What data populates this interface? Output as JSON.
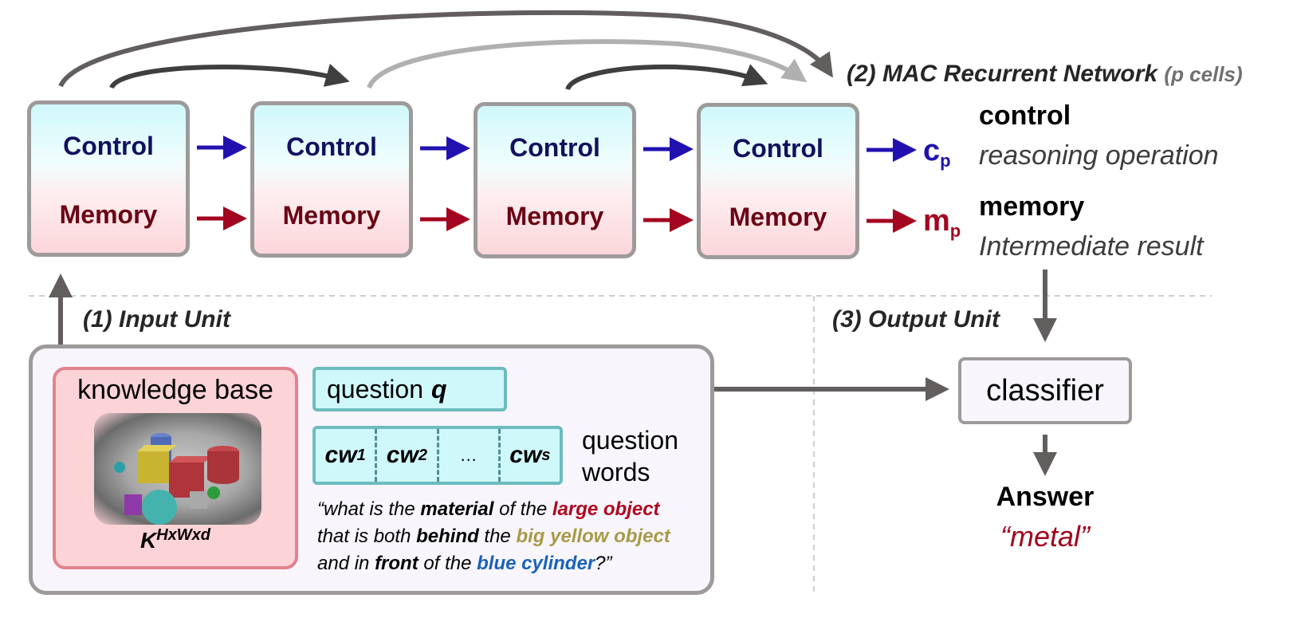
{
  "colors": {
    "control": "#2112b0",
    "memory": "#a3041f",
    "arrow_gray": "#625e5e",
    "arc_dark": "#3f3f3f",
    "arc_light": "#b0b0b0",
    "highlight_red": "#b0051e",
    "highlight_yellow": "#a89a48",
    "highlight_blue": "#1a63b7",
    "answer": "#a3041f"
  },
  "mac_network": {
    "title": "(2) MAC Recurrent Network",
    "title_suffix": "(p cells)",
    "cells": [
      {
        "control": "Control",
        "memory": "Memory"
      },
      {
        "control": "Control",
        "memory": "Memory"
      },
      {
        "control": "Control",
        "memory": "Memory"
      },
      {
        "control": "Control",
        "memory": "Memory"
      }
    ],
    "outputs": {
      "control_symbol": "c",
      "control_sub": "p",
      "memory_symbol": "m",
      "memory_sub": "p"
    },
    "legend": {
      "control_title": "control",
      "control_desc": "reasoning operation",
      "memory_title": "memory",
      "memory_desc": "Intermediate result"
    }
  },
  "input_unit": {
    "title": "(1) Input Unit",
    "knowledge_base": {
      "label": "knowledge base",
      "var": "K",
      "var_sup": "HxWxd",
      "image": "clevr-scene"
    },
    "question": {
      "label": "question",
      "var": "q"
    },
    "contextual_words": [
      {
        "text": "cw",
        "sub": "1"
      },
      {
        "text": "cw",
        "sub": "2"
      },
      {
        "text": "…",
        "sub": ""
      },
      {
        "text": "cw",
        "sub": "s"
      }
    ],
    "question_words_label": [
      "question",
      "words"
    ],
    "question_text": [
      [
        {
          "t": "“what is the ",
          "style": "plain"
        },
        {
          "t": "material",
          "style": "bold"
        },
        {
          "t": " of the ",
          "style": "plain"
        },
        {
          "t": "large object",
          "style": "red"
        }
      ],
      [
        {
          "t": "that is both ",
          "style": "plain"
        },
        {
          "t": "behind",
          "style": "bold"
        },
        {
          "t": " the ",
          "style": "plain"
        },
        {
          "t": "big yellow object",
          "style": "yellow"
        }
      ],
      [
        {
          "t": "and in ",
          "style": "plain"
        },
        {
          "t": "front",
          "style": "bold"
        },
        {
          "t": " of the ",
          "style": "plain"
        },
        {
          "t": "blue cylinder",
          "style": "blue"
        },
        {
          "t": "?”",
          "style": "plain"
        }
      ]
    ]
  },
  "output_unit": {
    "title": "(3) Output Unit",
    "classifier": "classifier",
    "answer_label": "Answer",
    "answer_value": "“metal”"
  }
}
